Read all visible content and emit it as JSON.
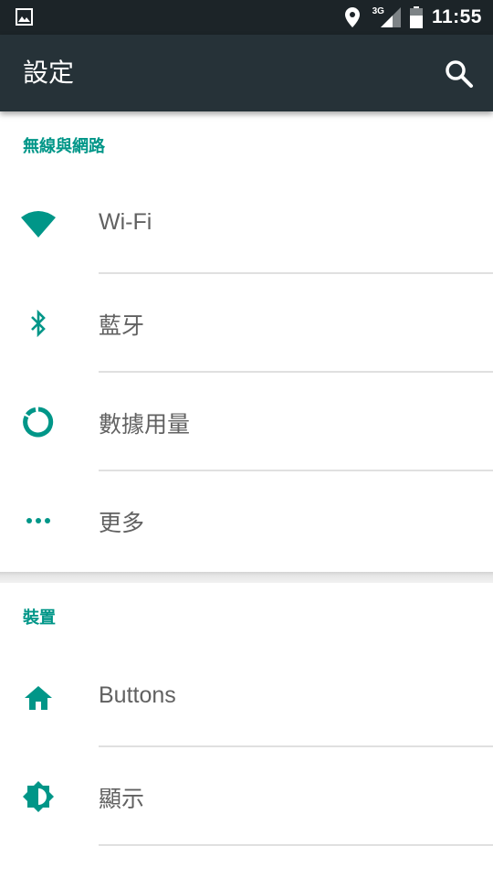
{
  "status_bar": {
    "time": "11:55",
    "network": "3G",
    "icons": [
      "image-icon",
      "location-icon",
      "signal-icon",
      "battery-icon"
    ]
  },
  "toolbar": {
    "title": "設定",
    "search_icon": "search-icon"
  },
  "colors": {
    "accent": "#009688",
    "toolbar": "#263238",
    "status_bar": "#1c2428",
    "text": "#616161",
    "divider": "#e0e0e0"
  },
  "sections": [
    {
      "header": "無線與網路",
      "items": [
        {
          "label": "Wi-Fi",
          "icon": "wifi-icon"
        },
        {
          "label": "藍牙",
          "icon": "bluetooth-icon"
        },
        {
          "label": "數據用量",
          "icon": "data-usage-icon"
        },
        {
          "label": "更多",
          "icon": "more-icon"
        }
      ]
    },
    {
      "header": "裝置",
      "items": [
        {
          "label": "Buttons",
          "icon": "home-icon"
        },
        {
          "label": "顯示",
          "icon": "brightness-icon"
        }
      ]
    }
  ]
}
